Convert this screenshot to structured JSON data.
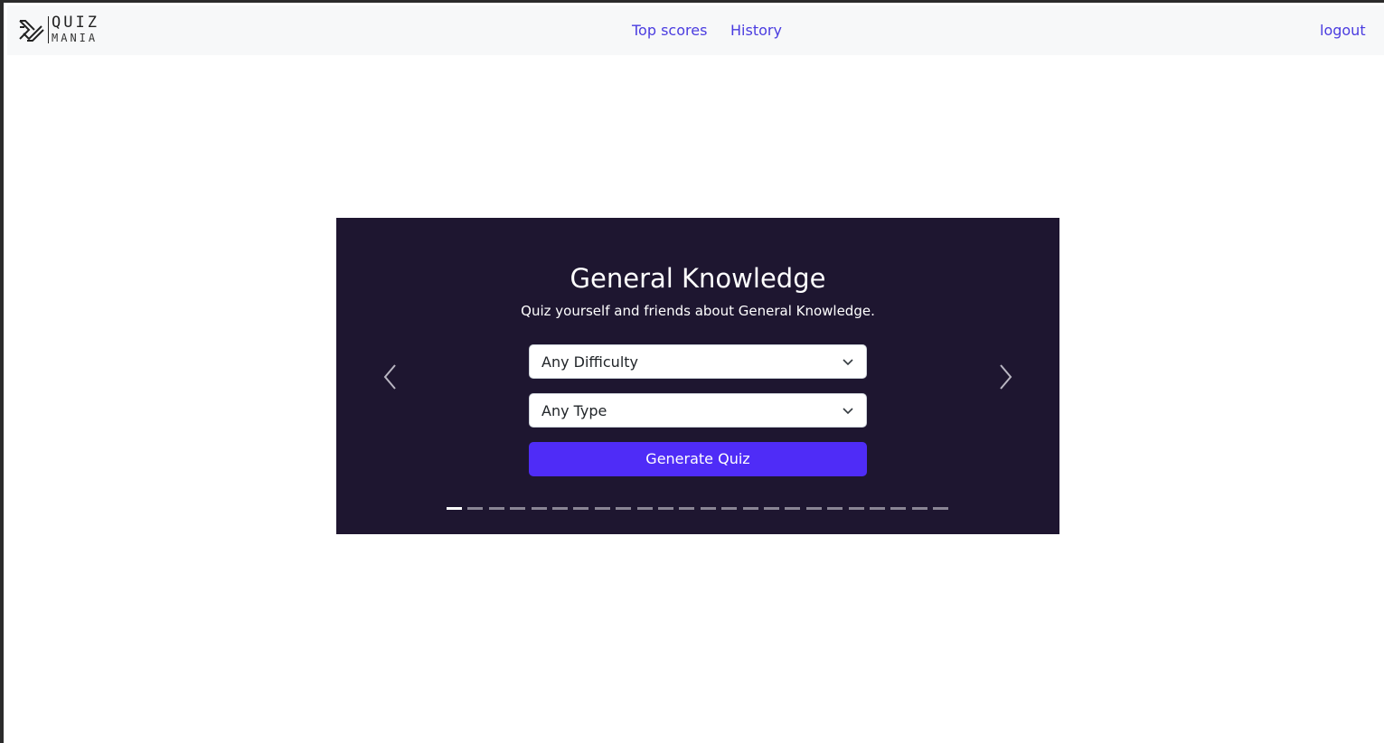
{
  "navbar": {
    "logo": {
      "word1": "QUIZ",
      "word2": "MANIA"
    },
    "links": {
      "top_scores": "Top scores",
      "history": "History",
      "logout": "logout"
    }
  },
  "carousel": {
    "title": "General Knowledge",
    "subtitle": "Quiz yourself and friends about General Knowledge.",
    "difficulty_select": {
      "value": "Any Difficulty"
    },
    "type_select": {
      "value": "Any Type"
    },
    "generate_button": "Generate Quiz",
    "prev_icon": "chevron-left-icon",
    "next_icon": "chevron-right-icon",
    "indicator_count": 24,
    "active_indicator": 0
  },
  "colors": {
    "link": "#4a3ce0",
    "carousel_bg": "#1e1630",
    "button": "#4f2cf7",
    "navbar_bg": "#f7f8f9"
  }
}
